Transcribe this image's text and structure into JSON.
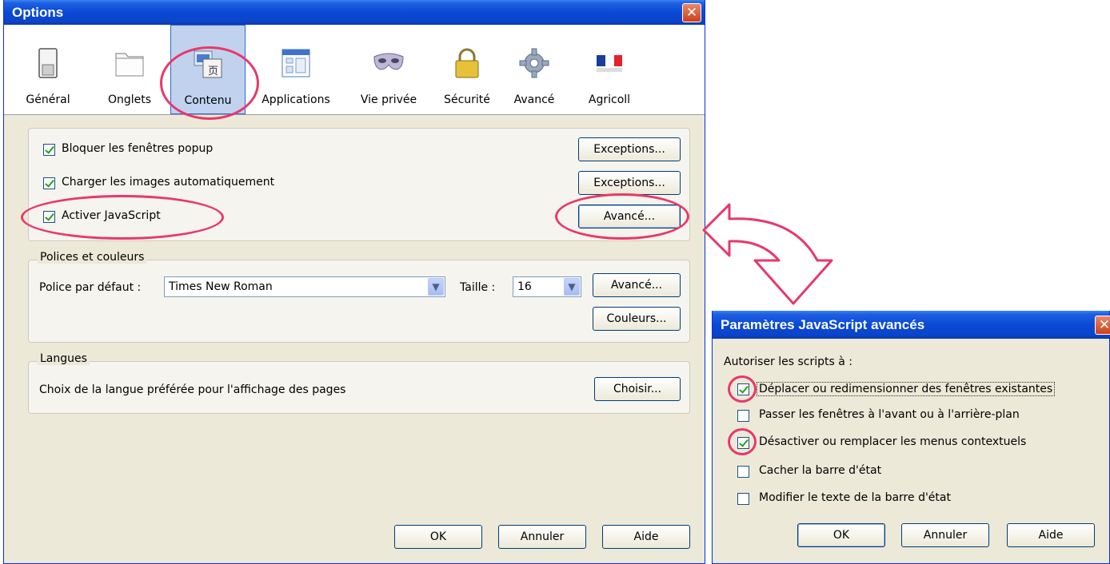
{
  "main_window": {
    "title": "Options",
    "tabs": [
      {
        "label": "Général",
        "icon": "switch-icon"
      },
      {
        "label": "Onglets",
        "icon": "folder-icon"
      },
      {
        "label": "Contenu",
        "icon": "content-page-icon"
      },
      {
        "label": "Applications",
        "icon": "applications-window-icon"
      },
      {
        "label": "Vie privée",
        "icon": "privacy-mask-icon"
      },
      {
        "label": "Sécurité",
        "icon": "padlock-icon"
      },
      {
        "label": "Avancé",
        "icon": "gear-icon"
      },
      {
        "label": "Agricoll",
        "icon": "flag-logo-icon"
      }
    ],
    "selected_tab": "Contenu",
    "content": {
      "block_popups": {
        "label": "Bloquer les fenêtres popup",
        "checked": true,
        "button": "Exceptions..."
      },
      "load_images": {
        "label": "Charger les images automatiquement",
        "checked": true,
        "button": "Exceptions..."
      },
      "enable_js": {
        "label": "Activer JavaScript",
        "checked": true,
        "button": "Avancé..."
      }
    },
    "fonts": {
      "caption": "Polices et couleurs",
      "default_font_label": "Police par défaut :",
      "default_font_value": "Times New Roman",
      "size_label": "Taille :",
      "size_value": "16",
      "advanced_button": "Avancé...",
      "colors_button": "Couleurs..."
    },
    "languages": {
      "caption": "Langues",
      "description": "Choix de la langue préférée pour l'affichage des pages",
      "choose_button": "Choisir..."
    },
    "buttons": {
      "ok": "OK",
      "cancel": "Annuler",
      "help": "Aide"
    }
  },
  "js_dialog": {
    "title": "Paramètres JavaScript avancés",
    "intro": "Autoriser les scripts à :",
    "options": [
      {
        "label": "Déplacer ou redimensionner des fenêtres existantes",
        "checked": true
      },
      {
        "label": "Passer les fenêtres à l'avant ou à l'arrière-plan",
        "checked": false
      },
      {
        "label": "Désactiver ou remplacer les menus contextuels",
        "checked": true
      },
      {
        "label": "Cacher la barre d'état",
        "checked": false
      },
      {
        "label": "Modifier le texte de la barre d'état",
        "checked": false
      }
    ],
    "buttons": {
      "ok": "OK",
      "cancel": "Annuler",
      "help": "Aide"
    }
  },
  "colors": {
    "highlight": "#e8386b",
    "title_blue": "#0a49d6",
    "face": "#ece9d8"
  }
}
